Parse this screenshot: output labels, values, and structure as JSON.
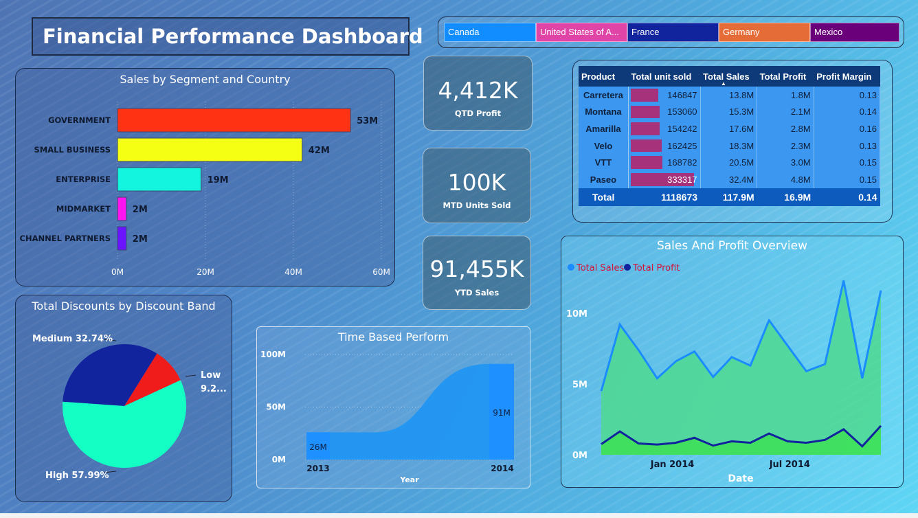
{
  "title": "Financial Performance Dashboard",
  "slicer": {
    "items": [
      {
        "label": "Canada",
        "color": "#118dff"
      },
      {
        "label": "United States of A...",
        "color": "#e044a7"
      },
      {
        "label": "France",
        "color": "#12239e"
      },
      {
        "label": "Germany",
        "color": "#e66c37"
      },
      {
        "label": "Mexico",
        "color": "#6b007b"
      }
    ]
  },
  "kpis": [
    {
      "value": "4,412K",
      "label": "QTD Profit"
    },
    {
      "value": "100K",
      "label": "MTD Units Sold"
    },
    {
      "value": "91,455K",
      "label": "YTD Sales"
    }
  ],
  "sales_by_segment": {
    "title": "Sales by Segment and Country",
    "tick_labels": [
      "0M",
      "20M",
      "40M",
      "60M"
    ]
  },
  "discounts": {
    "title": "Total Discounts by Discount Band",
    "labels": {
      "medium": "Medium 32.74%",
      "low_1": "Low",
      "low_2": "9.2...",
      "high": "High 57.99%"
    }
  },
  "time_based": {
    "title": "Time Based Perform",
    "xlabel": "Year",
    "y_ticks": [
      "100M",
      "50M",
      "0M"
    ]
  },
  "overview": {
    "title": "Sales And Profit Overview",
    "legend": [
      "Total Sales",
      "Total Profit"
    ],
    "xlabel": "Date",
    "x_ticks": [
      "Jan 2014",
      "Jul 2014"
    ],
    "y_ticks": [
      "10M",
      "5M",
      "0M"
    ]
  },
  "matrix": {
    "headers": [
      "Product",
      "Total unit sold",
      "Total Sales",
      "Total Profit",
      "Profit Margin"
    ],
    "rows": [
      {
        "product": "Carretera",
        "units": "146847",
        "sales": "13.8M",
        "profit": "1.8M",
        "margin": "0.13",
        "units_num": 146847
      },
      {
        "product": "Montana",
        "units": "153060",
        "sales": "15.3M",
        "profit": "2.1M",
        "margin": "0.14",
        "units_num": 153060
      },
      {
        "product": "Amarilla",
        "units": "154242",
        "sales": "17.6M",
        "profit": "2.8M",
        "margin": "0.16",
        "units_num": 154242
      },
      {
        "product": "Velo",
        "units": "162425",
        "sales": "18.3M",
        "profit": "2.3M",
        "margin": "0.13",
        "units_num": 162425
      },
      {
        "product": "VTT",
        "units": "168782",
        "sales": "20.5M",
        "profit": "3.0M",
        "margin": "0.15",
        "units_num": 168782
      },
      {
        "product": "Paseo",
        "units": "333317",
        "sales": "32.4M",
        "profit": "4.8M",
        "margin": "0.15",
        "units_num": 333317
      }
    ],
    "total": {
      "product": "Total",
      "units": "1118673",
      "sales": "117.9M",
      "profit": "16.9M",
      "margin": "0.14"
    }
  },
  "chart_data": [
    {
      "type": "bar",
      "orientation": "horizontal",
      "title": "Sales by Segment and Country",
      "categories": [
        "GOVERNMENT",
        "SMALL BUSINESS",
        "ENTERPRISE",
        "MIDMARKET",
        "CHANNEL PARTNERS"
      ],
      "values": [
        53,
        42,
        19,
        2,
        2
      ],
      "value_labels": [
        "53M",
        "42M",
        "19M",
        "2M",
        "2M"
      ],
      "colors": [
        "#ff3314",
        "#f5ff14",
        "#14f5e0",
        "#ff14f0",
        "#6a14ff"
      ],
      "xlim": [
        0,
        60
      ],
      "unit": "M"
    },
    {
      "type": "pie",
      "title": "Total Discounts by Discount Band",
      "labels": [
        "High",
        "Medium",
        "Low"
      ],
      "values": [
        57.99,
        32.74,
        9.27
      ],
      "colors": [
        "#14ffc4",
        "#12239e",
        "#f01c1c"
      ]
    },
    {
      "type": "area",
      "title": "Time Based Perform",
      "categories": [
        "2013",
        "2014"
      ],
      "values": [
        26,
        91
      ],
      "value_labels": [
        "26M",
        "91M"
      ],
      "xlabel": "Year",
      "ylim": [
        0,
        100
      ],
      "color": "#2196f3"
    },
    {
      "type": "area",
      "title": "Sales And Profit Overview",
      "xlabel": "Date",
      "ylim": [
        0,
        13
      ],
      "x": [
        "2013-09",
        "2013-10",
        "2013-11",
        "2013-12",
        "2014-01",
        "2014-02",
        "2014-03",
        "2014-04",
        "2014-05",
        "2014-06",
        "2014-07",
        "2014-08",
        "2014-09",
        "2014-10",
        "2014-11",
        "2014-12"
      ],
      "series": [
        {
          "name": "Total Sales",
          "values": [
            4.5,
            9.2,
            7.4,
            5.4,
            6.6,
            7.3,
            5.5,
            6.9,
            6.3,
            9.5,
            7.7,
            5.9,
            6.4,
            12.3,
            5.4,
            11.6
          ],
          "color": "#1a8cff"
        },
        {
          "name": "Total Profit",
          "values": [
            0.75,
            1.65,
            0.8,
            0.72,
            0.85,
            1.2,
            0.65,
            0.95,
            0.85,
            1.5,
            0.95,
            0.85,
            1.05,
            1.8,
            0.6,
            2.05
          ],
          "color": "#12239e"
        }
      ]
    }
  ]
}
